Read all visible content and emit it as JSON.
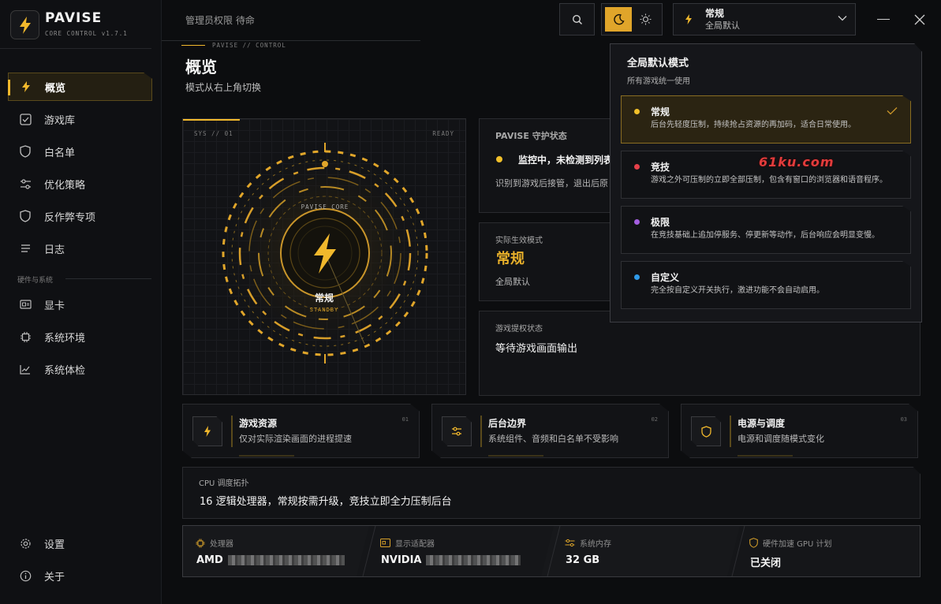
{
  "app": {
    "name": "PAVISE",
    "version": "CORE CONTROL v1.7.1",
    "admin_status": "管理员权限 待命",
    "breadcrumb": "PAVISE  //  CONTROL"
  },
  "sidebar": {
    "items": [
      {
        "label": "概览",
        "icon": "bolt-icon",
        "active": true
      },
      {
        "label": "游戏库",
        "icon": "check-square-icon"
      },
      {
        "label": "白名单",
        "icon": "shield-icon"
      },
      {
        "label": "优化策略",
        "icon": "sliders-icon"
      },
      {
        "label": "反作弊专项",
        "icon": "shield-icon"
      },
      {
        "label": "日志",
        "icon": "list-icon"
      }
    ],
    "hardware_section": "硬件与系统",
    "hardware_items": [
      {
        "label": "显卡",
        "icon": "gpu-icon"
      },
      {
        "label": "系统环境",
        "icon": "chip-icon"
      },
      {
        "label": "系统体检",
        "icon": "chart-icon"
      }
    ],
    "bottom_items": [
      {
        "label": "设置",
        "icon": "gear-icon"
      },
      {
        "label": "关于",
        "icon": "info-icon"
      }
    ]
  },
  "header": {
    "mode_select": {
      "label": "常规",
      "sub": "全局默认"
    }
  },
  "overview": {
    "title": "概览",
    "subtitle": "模式从右上角切换"
  },
  "radar": {
    "sys_label": "SYS // 01",
    "ready_label": "READY",
    "core_label": "PAVISE CORE",
    "mode": "常规",
    "state": "STANDBY"
  },
  "guard": {
    "title": "PAVISE 守护状态",
    "status": "监控中，未检测到列表",
    "desc": "识别到游戏后接管，退出后原"
  },
  "effective_mode": {
    "title": "实际生效模式",
    "mode": "常规",
    "sub": "全局默认"
  },
  "game_auth": {
    "title": "游戏提权状态",
    "text": "等待游戏画面输出"
  },
  "features": [
    {
      "title": "游戏资源",
      "desc": "仅对实际渲染画面的进程提速",
      "num": "01",
      "icon": "bolt-icon"
    },
    {
      "title": "后台边界",
      "desc": "系统组件、音频和白名单不受影响",
      "num": "02",
      "icon": "sliders-icon"
    },
    {
      "title": "电源与调度",
      "desc": "电源和调度随模式变化",
      "num": "03",
      "icon": "shield-icon"
    }
  ],
  "cpu_topology": {
    "title": "CPU 调度拓扑",
    "text": "16 逻辑处理器，常规按需升级，竞技立即全力压制后台"
  },
  "hardware": [
    {
      "label": "处理器",
      "value": "AMD",
      "icon": "chip-icon"
    },
    {
      "label": "显示适配器",
      "value": "NVIDIA",
      "icon": "gpu-icon"
    },
    {
      "label": "系统内存",
      "value": "32 GB",
      "icon": "sliders-icon"
    },
    {
      "label": "硬件加速 GPU 计划",
      "value": "已关闭",
      "icon": "shield-icon"
    }
  ],
  "dropdown": {
    "title": "全局默认模式",
    "subtitle": "所有游戏统一使用",
    "options": [
      {
        "name": "常规",
        "desc": "后台先轻度压制，持续抢占资源的再加码，适合日常使用。",
        "color": "#f1c02a",
        "selected": true
      },
      {
        "name": "竞技",
        "desc": "游戏之外可压制的立即全部压制，包含有窗口的浏览器和语音程序。",
        "color": "#e5404a"
      },
      {
        "name": "极限",
        "desc": "在竞技基础上追加停服务、停更新等动作，后台响应会明显变慢。",
        "color": "#a45ee0"
      },
      {
        "name": "自定义",
        "desc": "完全按自定义开关执行，激进功能不会自动启用。",
        "color": "#2f9ae8"
      }
    ]
  },
  "watermark": "61ku.com",
  "colors": {
    "accent": "#f1b82c",
    "background": "#0c0d0f"
  }
}
